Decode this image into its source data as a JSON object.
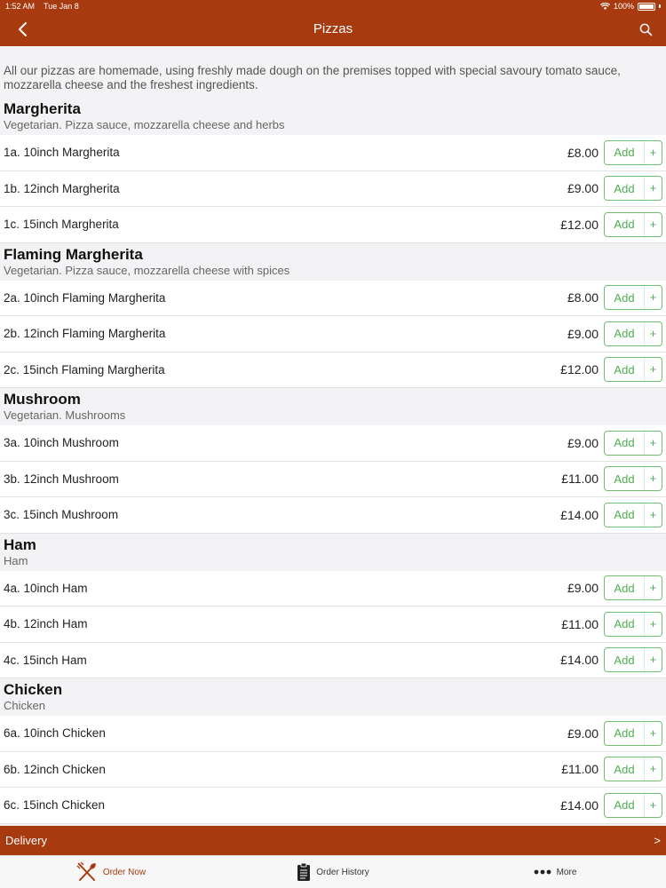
{
  "status": {
    "time": "1:52 AM",
    "date": "Tue Jan 8",
    "battery": "100%"
  },
  "nav": {
    "title": "Pizzas"
  },
  "intro": "All our pizzas are homemade, using freshly made dough on the premises topped with special savoury tomato sauce, mozzarella cheese and the freshest ingredients.",
  "add_label": "Add",
  "plus_label": "+",
  "sections": [
    {
      "title": "Margherita",
      "desc": "Vegetarian. Pizza sauce, mozzarella cheese and herbs",
      "items": [
        {
          "name": "1a. 10inch Margherita",
          "price": "£8.00"
        },
        {
          "name": "1b. 12inch Margherita",
          "price": "£9.00"
        },
        {
          "name": "1c. 15inch Margherita",
          "price": "£12.00"
        }
      ]
    },
    {
      "title": "Flaming Margherita",
      "desc": "Vegetarian. Pizza sauce, mozzarella cheese with spices",
      "items": [
        {
          "name": "2a. 10inch Flaming Margherita",
          "price": "£8.00"
        },
        {
          "name": "2b. 12inch Flaming Margherita",
          "price": "£9.00"
        },
        {
          "name": "2c. 15inch Flaming Margherita",
          "price": "£12.00"
        }
      ]
    },
    {
      "title": "Mushroom",
      "desc": "Vegetarian. Mushrooms",
      "items": [
        {
          "name": "3a. 10inch Mushroom",
          "price": "£9.00"
        },
        {
          "name": "3b. 12inch Mushroom",
          "price": "£11.00"
        },
        {
          "name": "3c. 15inch Mushroom",
          "price": "£14.00"
        }
      ]
    },
    {
      "title": "Ham",
      "desc": "Ham",
      "items": [
        {
          "name": "4a. 10inch Ham",
          "price": "£9.00"
        },
        {
          "name": "4b. 12inch Ham",
          "price": "£11.00"
        },
        {
          "name": "4c. 15inch Ham",
          "price": "£14.00"
        }
      ]
    },
    {
      "title": "Chicken",
      "desc": "Chicken",
      "items": [
        {
          "name": "6a. 10inch Chicken",
          "price": "£9.00"
        },
        {
          "name": "6b. 12inch Chicken",
          "price": "£11.00"
        },
        {
          "name": "6c. 15inch Chicken",
          "price": "£14.00"
        }
      ]
    }
  ],
  "delivery": {
    "label": "Delivery",
    "chevron": ">"
  },
  "tabs": [
    {
      "label": "Order Now",
      "icon": "utensils-icon",
      "active": true
    },
    {
      "label": "Order History",
      "icon": "clipboard-icon",
      "active": false
    },
    {
      "label": "More",
      "icon": "more-icon",
      "active": false
    }
  ],
  "colors": {
    "brand": "#a83a10",
    "add_green": "#4caf50"
  }
}
